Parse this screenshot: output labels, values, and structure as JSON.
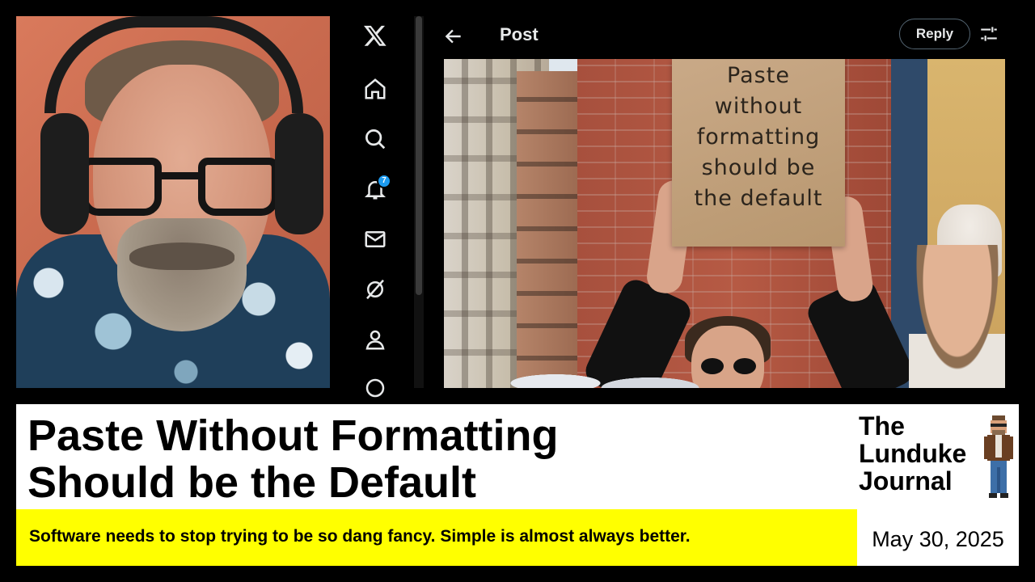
{
  "sidebar": {
    "items": [
      {
        "icon": "x-logo-icon",
        "label": ""
      },
      {
        "icon": "home-icon",
        "label": ""
      },
      {
        "icon": "search-icon",
        "label": ""
      },
      {
        "icon": "bell-icon",
        "badge": "7"
      },
      {
        "icon": "mail-icon",
        "label": ""
      },
      {
        "icon": "grok-icon",
        "label": ""
      },
      {
        "icon": "profile-icon",
        "label": ""
      }
    ]
  },
  "post": {
    "title": "Post",
    "reply_label": "Reply",
    "sign_lines": [
      "Paste",
      "without",
      "formatting",
      "should be",
      "the default"
    ]
  },
  "banner": {
    "headline_lines": [
      "Paste Without Formatting",
      "Should be the Default"
    ],
    "brand_lines": [
      "The",
      "Lunduke",
      "Journal"
    ],
    "subtitle": "Software needs to stop trying to be so dang fancy.  Simple is almost always better.",
    "date": "May 30, 2025"
  },
  "colors": {
    "accent_blue": "#1d9bf0",
    "banner_yellow": "#ffff00",
    "background": "#000000"
  }
}
